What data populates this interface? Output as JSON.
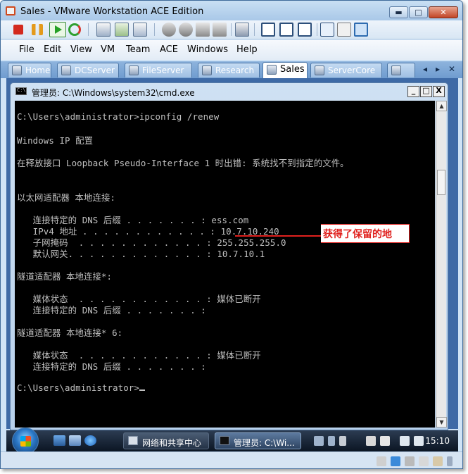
{
  "window": {
    "title": "Sales - VMware Workstation ACE Edition",
    "buttons": {
      "minimize": "▬",
      "maximize": "□",
      "close": "✕"
    }
  },
  "toolbar": {
    "icons": [
      "stop-icon",
      "pause-icon",
      "play-icon",
      "reset-icon",
      "snapshot-icon",
      "revert-snapshot-icon",
      "snapshot-manager-icon",
      "settings-icon",
      "network-icon",
      "usb-icon",
      "sound-icon",
      "capture-icon",
      "summary-view-icon",
      "console-view-icon",
      "fullscreen-icon",
      "quick-switch-icon",
      "unity-icon",
      "library-icon"
    ]
  },
  "menu": [
    "File",
    "Edit",
    "View",
    "VM",
    "Team",
    "ACE",
    "Windows",
    "Help"
  ],
  "tabs": [
    {
      "label": "Home",
      "active": false
    },
    {
      "label": "DCServer",
      "active": false
    },
    {
      "label": "FileServer",
      "active": false
    },
    {
      "label": "Research",
      "active": false
    },
    {
      "label": "Sales",
      "active": true
    },
    {
      "label": "ServerCore",
      "active": false
    }
  ],
  "tab_nav": {
    "left": "◂",
    "right": "▸",
    "close": "✕"
  },
  "cmd": {
    "icon_text": "C:\\",
    "title": "管理员: C:\\Windows\\system32\\cmd.exe",
    "buttons": {
      "minimize": "_",
      "maximize": "□",
      "close": "X"
    },
    "lines": [
      "C:\\Users\\administrator>ipconfig /renew",
      "Windows IP 配置",
      "在释放接口 Loopback Pseudo-Interface 1 时出错: 系统找不到指定的文件。",
      "以太网适配器 本地连接:",
      "   连接特定的 DNS 后缀 . . . . . . . : ess.com",
      "   IPv4 地址 . . . . . . . . . . . . : 10.7.10.240",
      "   子网掩码  . . . . . . . . . . . . : 255.255.255.0",
      "   默认网关. . . . . . . . . . . . . : 10.7.10.1",
      "隧道适配器 本地连接*:",
      "   媒体状态  . . . . . . . . . . . . : 媒体已断开",
      "   连接特定的 DNS 后缀 . . . . . . . :",
      "隧道适配器 本地连接* 6:",
      "   媒体状态  . . . . . . . . . . . . : 媒体已断开",
      "   连接特定的 DNS 后缀 . . . . . . . :",
      "C:\\Users\\administrator>"
    ],
    "scroll": {
      "up": "▲",
      "down": "▼"
    }
  },
  "annotation": {
    "text": "获得了保留的地",
    "color": "#e0211e"
  },
  "taskbar": {
    "buttons": [
      {
        "label": "网络和共享中心",
        "active": false
      },
      {
        "label": "管理员: C:\\Wi...",
        "active": true
      }
    ],
    "clock": "15:10"
  },
  "colors": {
    "console_bg": "#000000",
    "console_fg": "#c0c0c0",
    "tab_bar": "#6f9ccf"
  }
}
